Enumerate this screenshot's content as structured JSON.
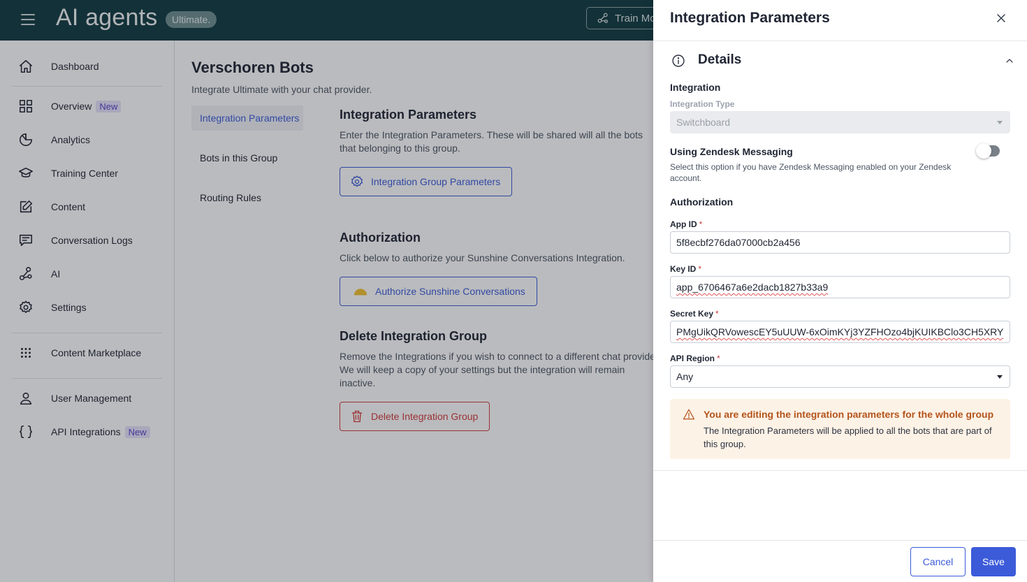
{
  "app": {
    "title": "AI agents",
    "brand_badge": "Ultimate.",
    "train_button": "Train Mo"
  },
  "sidebar": {
    "items": [
      {
        "label": "Dashboard",
        "icon": "home-icon",
        "badge": ""
      },
      {
        "label": "Overview",
        "icon": "grid-icon",
        "badge": "New"
      },
      {
        "label": "Analytics",
        "icon": "pie-chart-icon",
        "badge": ""
      },
      {
        "label": "Training Center",
        "icon": "graduation-cap-icon",
        "badge": ""
      },
      {
        "label": "Content",
        "icon": "edit-icon",
        "badge": ""
      },
      {
        "label": "Conversation Logs",
        "icon": "chat-icon",
        "badge": ""
      },
      {
        "label": "AI",
        "icon": "nodes-icon",
        "badge": ""
      },
      {
        "label": "Settings",
        "icon": "gear-icon",
        "badge": ""
      },
      {
        "label": "Content Marketplace",
        "icon": "dots-grid-icon",
        "badge": ""
      },
      {
        "label": "User Management",
        "icon": "user-icon",
        "badge": ""
      },
      {
        "label": "API Integrations",
        "icon": "braces-icon",
        "badge": "New"
      }
    ]
  },
  "main": {
    "page_title": "Verschoren Bots",
    "page_subtitle": "Integrate Ultimate with your chat provider.",
    "subnav": [
      "Integration Parameters",
      "Bots in this Group",
      "Routing Rules"
    ],
    "params": {
      "title": "Integration Parameters",
      "text": "Enter the Integration Parameters. These will be shared will all the bots that belonging to this group.",
      "button": "Integration Group Parameters"
    },
    "auth": {
      "title": "Authorization",
      "text": "Click below to authorize your Sunshine Conversations Integration.",
      "button": "Authorize Sunshine Conversations"
    },
    "delete": {
      "title": "Delete Integration Group",
      "text": "Remove the Integrations if you wish to connect to a different chat provider. We will keep a copy of your settings but the integration will remain inactive.",
      "button": "Delete Integration Group"
    }
  },
  "drawer": {
    "title": "Integration Parameters",
    "section_title": "Details",
    "integration_heading": "Integration",
    "integration_type_label": "Integration Type",
    "integration_type_value": "Switchboard",
    "zendesk_label": "Using Zendesk Messaging",
    "zendesk_help": "Select this option if you have Zendesk Messaging enabled on your Zendesk account.",
    "zendesk_enabled": false,
    "authorization_heading": "Authorization",
    "app_id_label": "App ID",
    "app_id_value": "5f8ecbf276da07000cb2a456",
    "key_id_label": "Key ID",
    "key_id_value": "app_6706467a6e2dacb1827b33a9",
    "secret_key_label": "Secret Key",
    "secret_key_value": "PMgUikQRVowescEY5uUUW-6xOimKYj3YZFHOzo4bjKUIKBClo3CH5XRY",
    "api_region_label": "API Region",
    "api_region_value": "Any",
    "required_mark": "*",
    "warning_title": "You are editing the integration parameters for the whole group",
    "warning_text": "The Integration Parameters will be applied to all the bots that are part of this group.",
    "cancel_label": "Cancel",
    "save_label": "Save"
  },
  "colors": {
    "topbar": "#113a3f",
    "accent": "#3b5bd9",
    "danger": "#d13c3c",
    "warning_bg": "#fdf2e6",
    "warning_text": "#b4541b"
  }
}
